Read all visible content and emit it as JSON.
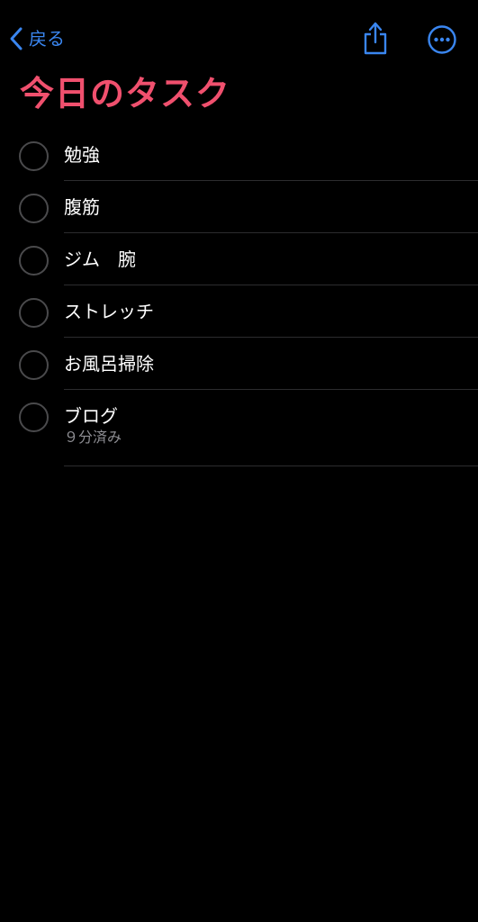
{
  "nav": {
    "back_label": "戻る",
    "back_icon": "chevron-left-icon",
    "share_icon": "share-icon",
    "more_icon": "ellipsis-circle-icon"
  },
  "list": {
    "title": "今日のタスク"
  },
  "tasks": [
    {
      "title": "勉強",
      "note": ""
    },
    {
      "title": "腹筋",
      "note": ""
    },
    {
      "title": "ジム　腕",
      "note": ""
    },
    {
      "title": "ストレッチ",
      "note": ""
    },
    {
      "title": "お風呂掃除",
      "note": ""
    },
    {
      "title": "ブログ",
      "note": "９分済み"
    }
  ],
  "colors": {
    "background": "#000000",
    "accent_blue": "#3a86f0",
    "title_pink": "#f0506e",
    "circle_gray": "#4a4a4c",
    "note_gray": "#8e8e93",
    "separator": "#2c2c2e"
  }
}
